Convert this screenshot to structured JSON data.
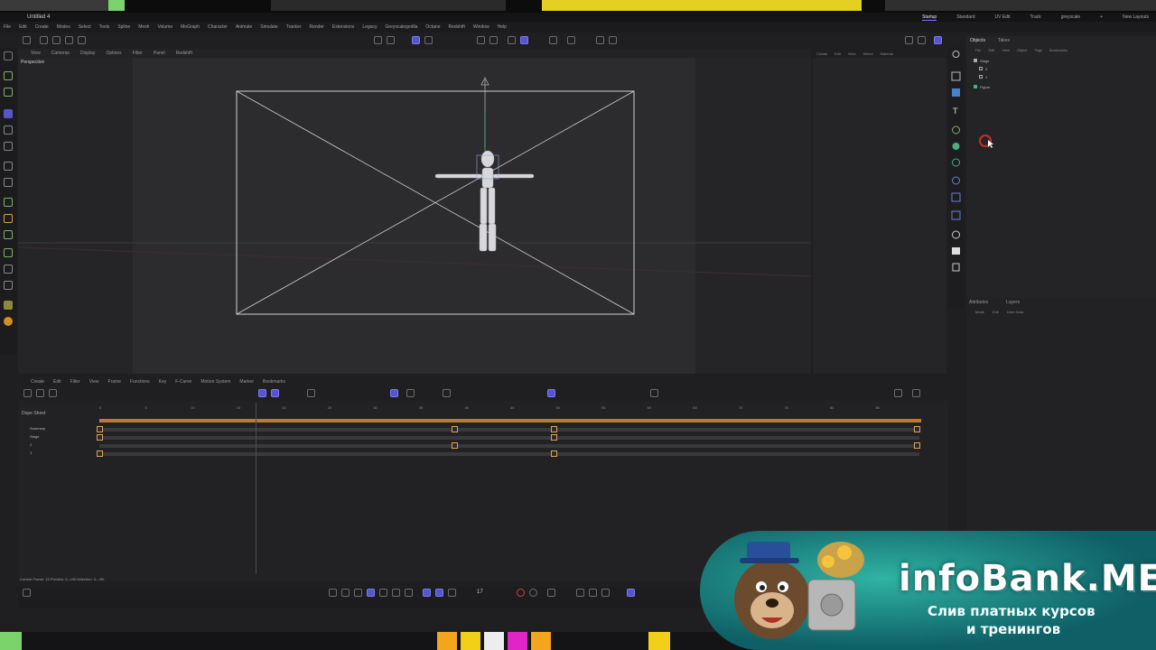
{
  "titlebar": {
    "doc_title": "Untitled 4"
  },
  "layouts": [
    "Startup",
    "Standard",
    "UV Edit",
    "Track",
    "greyscale",
    "+",
    "New Layouts"
  ],
  "menu": [
    "File",
    "Edit",
    "Create",
    "Modes",
    "Select",
    "Tools",
    "Spline",
    "Mesh",
    "Volume",
    "MoGraph",
    "Character",
    "Animate",
    "Simulate",
    "Tracker",
    "Render",
    "Extensions",
    "Legacy",
    "Greyscalegorilla",
    "Octane",
    "Redshift",
    "Window",
    "Help"
  ],
  "viewport": {
    "menu": [
      "View",
      "Cameras",
      "Display",
      "Options",
      "Filter",
      "Panel",
      "Redshift"
    ],
    "label": "Perspective"
  },
  "objects": {
    "tabs": [
      "Objects",
      "Takes"
    ],
    "menu": [
      "File",
      "Edit",
      "View",
      "Object",
      "Tags",
      "Bookmarks"
    ],
    "items": [
      "Stage",
      "2",
      "1",
      "Figure"
    ]
  },
  "side_menu": [
    "Create",
    "Edit",
    "View",
    "Select",
    "Material"
  ],
  "attributes": {
    "tabs": [
      "Attributes",
      "Layers"
    ],
    "menu": [
      "Mode",
      "Edit",
      "User Data"
    ]
  },
  "timeline": {
    "menu": [
      "Create",
      "Edit",
      "Filter",
      "View",
      "Frame",
      "Functions",
      "Key",
      "F-Curve",
      "Motion System",
      "Marker",
      "Bookmarks"
    ],
    "dope_sheet_label": "Dope Sheet",
    "tracks": [
      "Summary",
      "Stage",
      "2",
      "1"
    ],
    "ruler_ticks": [
      "0",
      "5",
      "10",
      "15",
      "20",
      "25",
      "30",
      "35",
      "40",
      "45",
      "50",
      "55",
      "60",
      "65",
      "70",
      "75",
      "80",
      "85",
      "90"
    ],
    "status": "Current Frame: 15  Preview: 0-->90   Selection: 0-->90",
    "current_frame": "17"
  },
  "watermark": {
    "brand": "infoBank.ME",
    "line1": "Слив платных курсов",
    "line2": "и тренингов"
  },
  "colors": {
    "accent": "#5656c8",
    "key_orange": "#e4a24a",
    "summary_bar": "#c07a2f",
    "watermark_teal": "#1f8f88"
  }
}
